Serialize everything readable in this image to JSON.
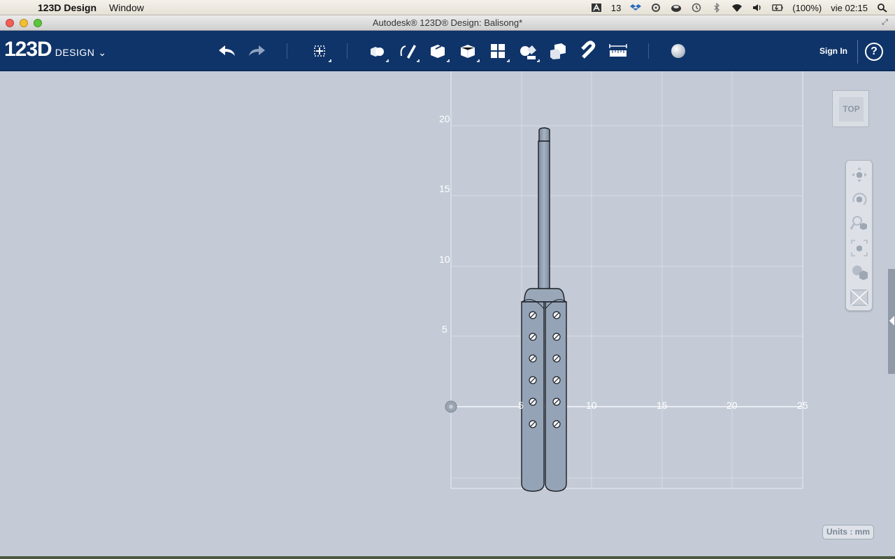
{
  "menubar": {
    "app_name": "123D Design",
    "menus": [
      "Window"
    ],
    "tray_badge": "13",
    "battery": "(100%)",
    "clock": "vie 02:15"
  },
  "window": {
    "title": "Autodesk® 123D® Design: Balisong*"
  },
  "toolbar": {
    "logo_main": "123D",
    "logo_sub": "DESIGN",
    "sign_in": "Sign In",
    "help": "?"
  },
  "canvas": {
    "y_labels": [
      "20",
      "15",
      "10",
      "5"
    ],
    "x_labels": [
      "5",
      "10",
      "15",
      "20",
      "25"
    ],
    "view_cube_face": "TOP",
    "units": "Units : mm"
  },
  "colors": {
    "toolbar_bg": "#0f3469",
    "canvas_bg": "#c4cbd6",
    "grid_line": "#e8ecf2",
    "model_fill": "#95a3b6"
  },
  "icons": {
    "toolbar": [
      "undo-icon",
      "redo-icon",
      "transform-icon",
      "primitives-icon",
      "sketch-icon",
      "construct-icon",
      "modify-icon",
      "pattern-icon",
      "grouping-icon",
      "combine-icon",
      "snap-icon",
      "measure-icon",
      "material-icon"
    ],
    "navbar": [
      "pan-icon",
      "orbit-icon",
      "zoom-icon",
      "fit-icon",
      "visual-style-icon",
      "hide-grid-icon"
    ]
  }
}
